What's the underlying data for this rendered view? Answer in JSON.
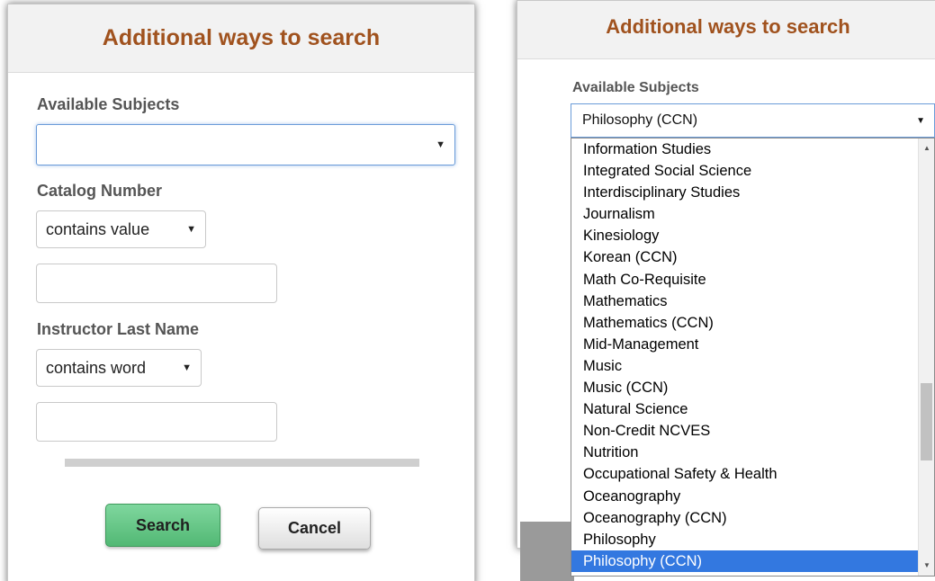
{
  "left_panel": {
    "title": "Additional ways to search",
    "available_subjects_label": "Available Subjects",
    "available_subjects_value": "",
    "catalog_number_label": "Catalog Number",
    "catalog_operator": "contains value",
    "catalog_value": "",
    "instructor_label": "Instructor Last Name",
    "instructor_operator": "contains word",
    "instructor_value": "",
    "search_button": "Search",
    "cancel_button": "Cancel"
  },
  "right_panel": {
    "title": "Additional ways to search",
    "available_subjects_label": "Available Subjects",
    "selected_subject": "Philosophy (CCN)",
    "options": [
      "Information Studies",
      "Integrated Social Science",
      "Interdisciplinary Studies",
      "Journalism",
      "Kinesiology",
      "Korean (CCN)",
      "Math Co-Requisite",
      "Mathematics",
      "Mathematics (CCN)",
      "Mid-Management",
      "Music",
      "Music (CCN)",
      "Natural Science",
      "Non-Credit NCVES",
      "Nutrition",
      "Occupational Safety & Health",
      "Oceanography",
      "Oceanography (CCN)",
      "Philosophy",
      "Philosophy (CCN)"
    ],
    "highlighted_index": 19
  },
  "icons": {
    "dropdown_arrow": "chevron-down-icon",
    "scroll_up": "scroll-up-icon",
    "scroll_down": "scroll-down-icon"
  },
  "colors": {
    "title": "#a0521e",
    "search_button": "#52b874",
    "highlight": "#3378e0",
    "focus_border": "#6a9bd8"
  }
}
